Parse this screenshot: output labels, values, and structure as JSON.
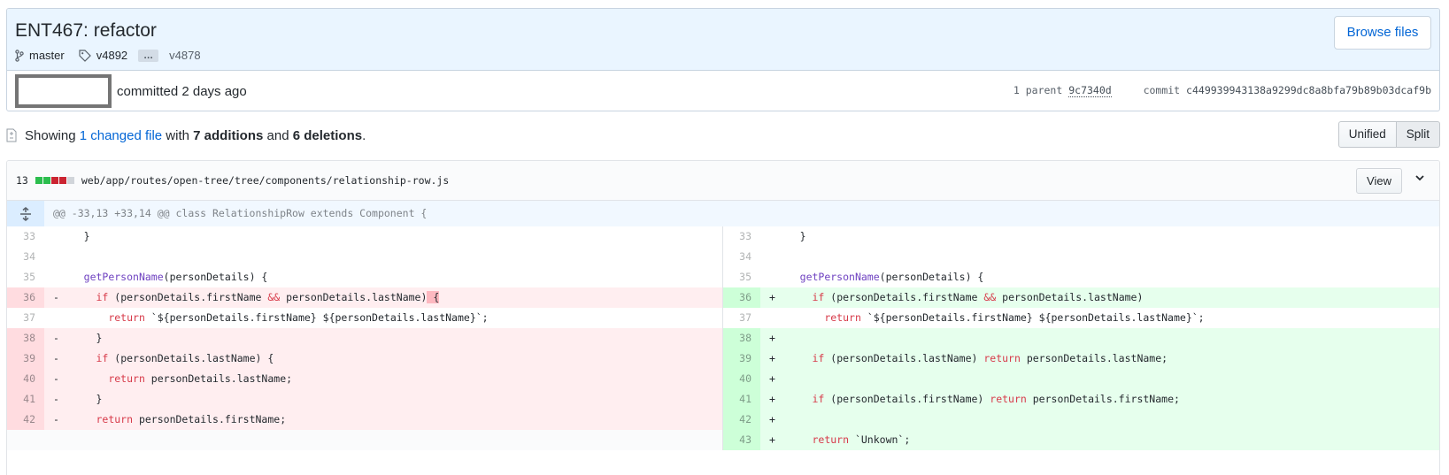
{
  "commit": {
    "title": "ENT467: refactor",
    "branch": "master",
    "tag_first": "v4892",
    "ellipsis": "…",
    "tag_last": "v4878",
    "browse_label": "Browse files",
    "committed_text": "committed 2 days ago",
    "parent_label": "1 parent",
    "parent_sha": "9c7340d",
    "commit_label": "commit",
    "commit_sha": "c449939943138a9299dc8a8bfa79b89b03dcaf9b"
  },
  "toc": {
    "showing": "Showing",
    "changed_files": "1 changed file",
    "with": "with",
    "additions": "7 additions",
    "and": "and",
    "deletions": "6 deletions",
    "period": ".",
    "unified_label": "Unified",
    "split_label": "Split",
    "selected_view": "Split"
  },
  "file": {
    "changes_count": "13",
    "path": "web/app/routes/open-tree/tree/components/relationship-row.js",
    "view_label": "View",
    "hunk_header": "@@ -33,13 +33,14 @@ class RelationshipRow extends Component {",
    "colors": {
      "addition": "#2cbe4e",
      "deletion": "#cb2431",
      "neutral": "#d1d5da"
    }
  },
  "left_lines": [
    {
      "num": "33",
      "type": "ctx",
      "sign": " ",
      "segments": [
        {
          "t": "  }",
          "c": ""
        }
      ]
    },
    {
      "num": "34",
      "type": "ctx",
      "sign": " ",
      "segments": [
        {
          "t": "",
          "c": ""
        }
      ]
    },
    {
      "num": "35",
      "type": "ctx",
      "sign": " ",
      "segments": [
        {
          "t": "  ",
          "c": ""
        },
        {
          "t": "getPersonName",
          "c": "fn"
        },
        {
          "t": "(personDetails) {",
          "c": ""
        }
      ]
    },
    {
      "num": "36",
      "type": "del",
      "sign": "-",
      "segments": [
        {
          "t": "    ",
          "c": ""
        },
        {
          "t": "if",
          "c": "kw"
        },
        {
          "t": " (personDetails.firstName ",
          "c": ""
        },
        {
          "t": "&&",
          "c": "kw"
        },
        {
          "t": " personDetails.lastName)",
          "c": ""
        },
        {
          "t": " {",
          "c": "hl-del"
        }
      ]
    },
    {
      "num": "37",
      "type": "ctx",
      "sign": " ",
      "segments": [
        {
          "t": "      ",
          "c": ""
        },
        {
          "t": "return",
          "c": "kw"
        },
        {
          "t": " `${personDetails.firstName} ${personDetails.lastName}`;",
          "c": ""
        }
      ]
    },
    {
      "num": "38",
      "type": "del",
      "sign": "-",
      "segments": [
        {
          "t": "    }",
          "c": ""
        }
      ]
    },
    {
      "num": "39",
      "type": "del",
      "sign": "-",
      "segments": [
        {
          "t": "    ",
          "c": ""
        },
        {
          "t": "if",
          "c": "kw"
        },
        {
          "t": " (personDetails.lastName) {",
          "c": ""
        }
      ]
    },
    {
      "num": "40",
      "type": "del",
      "sign": "-",
      "segments": [
        {
          "t": "      ",
          "c": ""
        },
        {
          "t": "return",
          "c": "kw"
        },
        {
          "t": " personDetails.lastName;",
          "c": ""
        }
      ]
    },
    {
      "num": "41",
      "type": "del",
      "sign": "-",
      "segments": [
        {
          "t": "    }",
          "c": ""
        }
      ]
    },
    {
      "num": "42",
      "type": "del",
      "sign": "-",
      "segments": [
        {
          "t": "    ",
          "c": ""
        },
        {
          "t": "return",
          "c": "kw"
        },
        {
          "t": " personDetails.firstName;",
          "c": ""
        }
      ]
    },
    {
      "num": "",
      "type": "empty",
      "sign": "",
      "segments": []
    }
  ],
  "right_lines": [
    {
      "num": "33",
      "type": "ctx",
      "sign": " ",
      "segments": [
        {
          "t": "  }",
          "c": ""
        }
      ]
    },
    {
      "num": "34",
      "type": "ctx",
      "sign": " ",
      "segments": [
        {
          "t": "",
          "c": ""
        }
      ]
    },
    {
      "num": "35",
      "type": "ctx",
      "sign": " ",
      "segments": [
        {
          "t": "  ",
          "c": ""
        },
        {
          "t": "getPersonName",
          "c": "fn"
        },
        {
          "t": "(personDetails) {",
          "c": ""
        }
      ]
    },
    {
      "num": "36",
      "type": "add",
      "sign": "+",
      "segments": [
        {
          "t": "    ",
          "c": ""
        },
        {
          "t": "if",
          "c": "kw"
        },
        {
          "t": " (personDetails.firstName ",
          "c": ""
        },
        {
          "t": "&&",
          "c": "kw"
        },
        {
          "t": " personDetails.lastName)",
          "c": ""
        }
      ]
    },
    {
      "num": "37",
      "type": "ctx",
      "sign": " ",
      "segments": [
        {
          "t": "      ",
          "c": ""
        },
        {
          "t": "return",
          "c": "kw"
        },
        {
          "t": " `${personDetails.firstName} ${personDetails.lastName}`;",
          "c": ""
        }
      ]
    },
    {
      "num": "38",
      "type": "add",
      "sign": "+",
      "segments": []
    },
    {
      "num": "39",
      "type": "add",
      "sign": "+",
      "segments": [
        {
          "t": "    ",
          "c": ""
        },
        {
          "t": "if",
          "c": "kw"
        },
        {
          "t": " (personDetails.lastName) ",
          "c": ""
        },
        {
          "t": "return",
          "c": "kw"
        },
        {
          "t": " personDetails.lastName;",
          "c": ""
        }
      ]
    },
    {
      "num": "40",
      "type": "add",
      "sign": "+",
      "segments": []
    },
    {
      "num": "41",
      "type": "add",
      "sign": "+",
      "segments": [
        {
          "t": "    ",
          "c": ""
        },
        {
          "t": "if",
          "c": "kw"
        },
        {
          "t": " (personDetails.firstName) ",
          "c": ""
        },
        {
          "t": "return",
          "c": "kw"
        },
        {
          "t": " personDetails.firstName;",
          "c": ""
        }
      ]
    },
    {
      "num": "42",
      "type": "add",
      "sign": "+",
      "segments": []
    },
    {
      "num": "43",
      "type": "add",
      "sign": "+",
      "segments": [
        {
          "t": "    ",
          "c": ""
        },
        {
          "t": "return",
          "c": "kw"
        },
        {
          "t": " `Unkown`;",
          "c": ""
        }
      ]
    }
  ]
}
